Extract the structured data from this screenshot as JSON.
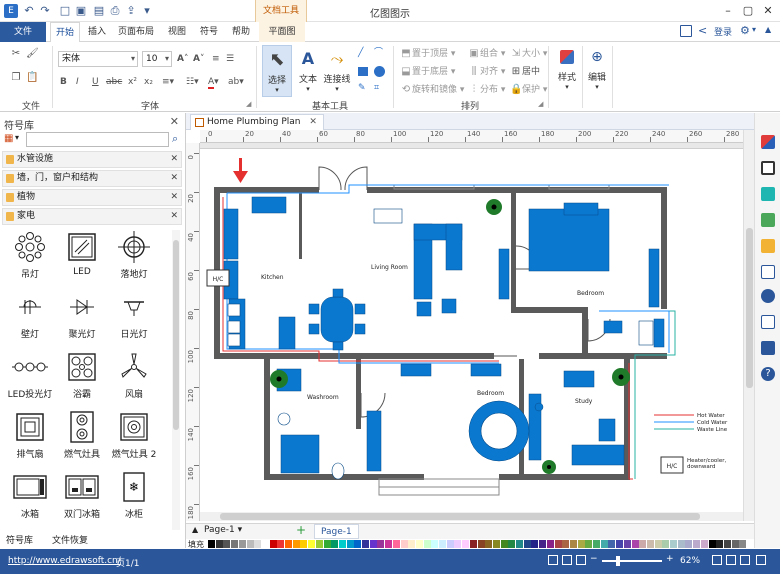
{
  "app": {
    "title": "亿图图示",
    "context_tab_group": "文档工具"
  },
  "tabs": [
    "文件",
    "开始",
    "插入",
    "页面布局",
    "视图",
    "符号",
    "帮助",
    "平面图"
  ],
  "header_right": {
    "login": "登录"
  },
  "ribbon": {
    "font_name": "宋体",
    "font_size": "10",
    "groups": [
      "文件",
      "字体",
      "基本工具",
      "排列"
    ],
    "tools": {
      "select": "选择",
      "text": "文本",
      "connector": "连接线",
      "style": "样式",
      "edit": "编辑"
    },
    "arrange": {
      "bring_front": "置于顶层",
      "send_back": "置于底层",
      "rotate_mirror": "旋转和镜像",
      "group": "组合",
      "align": "对齐",
      "distribute": "分布",
      "size": "大小",
      "center": "居中",
      "protect": "保护"
    }
  },
  "library": {
    "title": "符号库",
    "search_placeholder": "",
    "categories": [
      "水管设施",
      "墙，门，窗户和结构",
      "植物",
      "家电"
    ],
    "symbols": [
      "吊灯",
      "LED",
      "落地灯",
      "壁灯",
      "聚光灯",
      "日光灯",
      "LED投光灯",
      "浴霸",
      "风扇",
      "排气扇",
      "燃气灶具",
      "燃气灶具 2",
      "冰箱",
      "双门冰箱",
      "冰柜"
    ],
    "bottom_tabs": [
      "符号库",
      "文件恢复"
    ]
  },
  "document": {
    "tab_title": "Home Plumbing Plan",
    "ruler_ticks": [
      "0",
      "20",
      "40",
      "60",
      "80",
      "100",
      "120",
      "140",
      "160",
      "180",
      "200",
      "220",
      "240",
      "260",
      "280"
    ],
    "ruler_left_ticks": [
      "0",
      "20",
      "40",
      "60",
      "80",
      "100",
      "120",
      "140",
      "160",
      "180"
    ],
    "room_labels": {
      "kitchen": "Kitchen",
      "living": "Living Room",
      "bedroom1": "Bedroom",
      "washroom": "Washroom",
      "bedroom2": "Bedroom",
      "study": "Study"
    },
    "legend": [
      {
        "label": "Hot Water",
        "color": "#e0312f"
      },
      {
        "label": "Cold Water",
        "color": "#1e90ff"
      },
      {
        "label": "Waste Line",
        "color": "#2ab0a5"
      }
    ],
    "heater_label": "Heater/cooler,\ndownward",
    "hvac_label": "H/C"
  },
  "pages": {
    "current": "Page-1",
    "tab": "Page-1"
  },
  "palette_label": "填充",
  "status": {
    "url": "http://www.edrawsoft.cn/",
    "page_info": "页1/1",
    "zoom": "62%"
  },
  "colors": {
    "accent": "#2b579a",
    "fixture": "#0b78d0",
    "wall": "#555555"
  }
}
